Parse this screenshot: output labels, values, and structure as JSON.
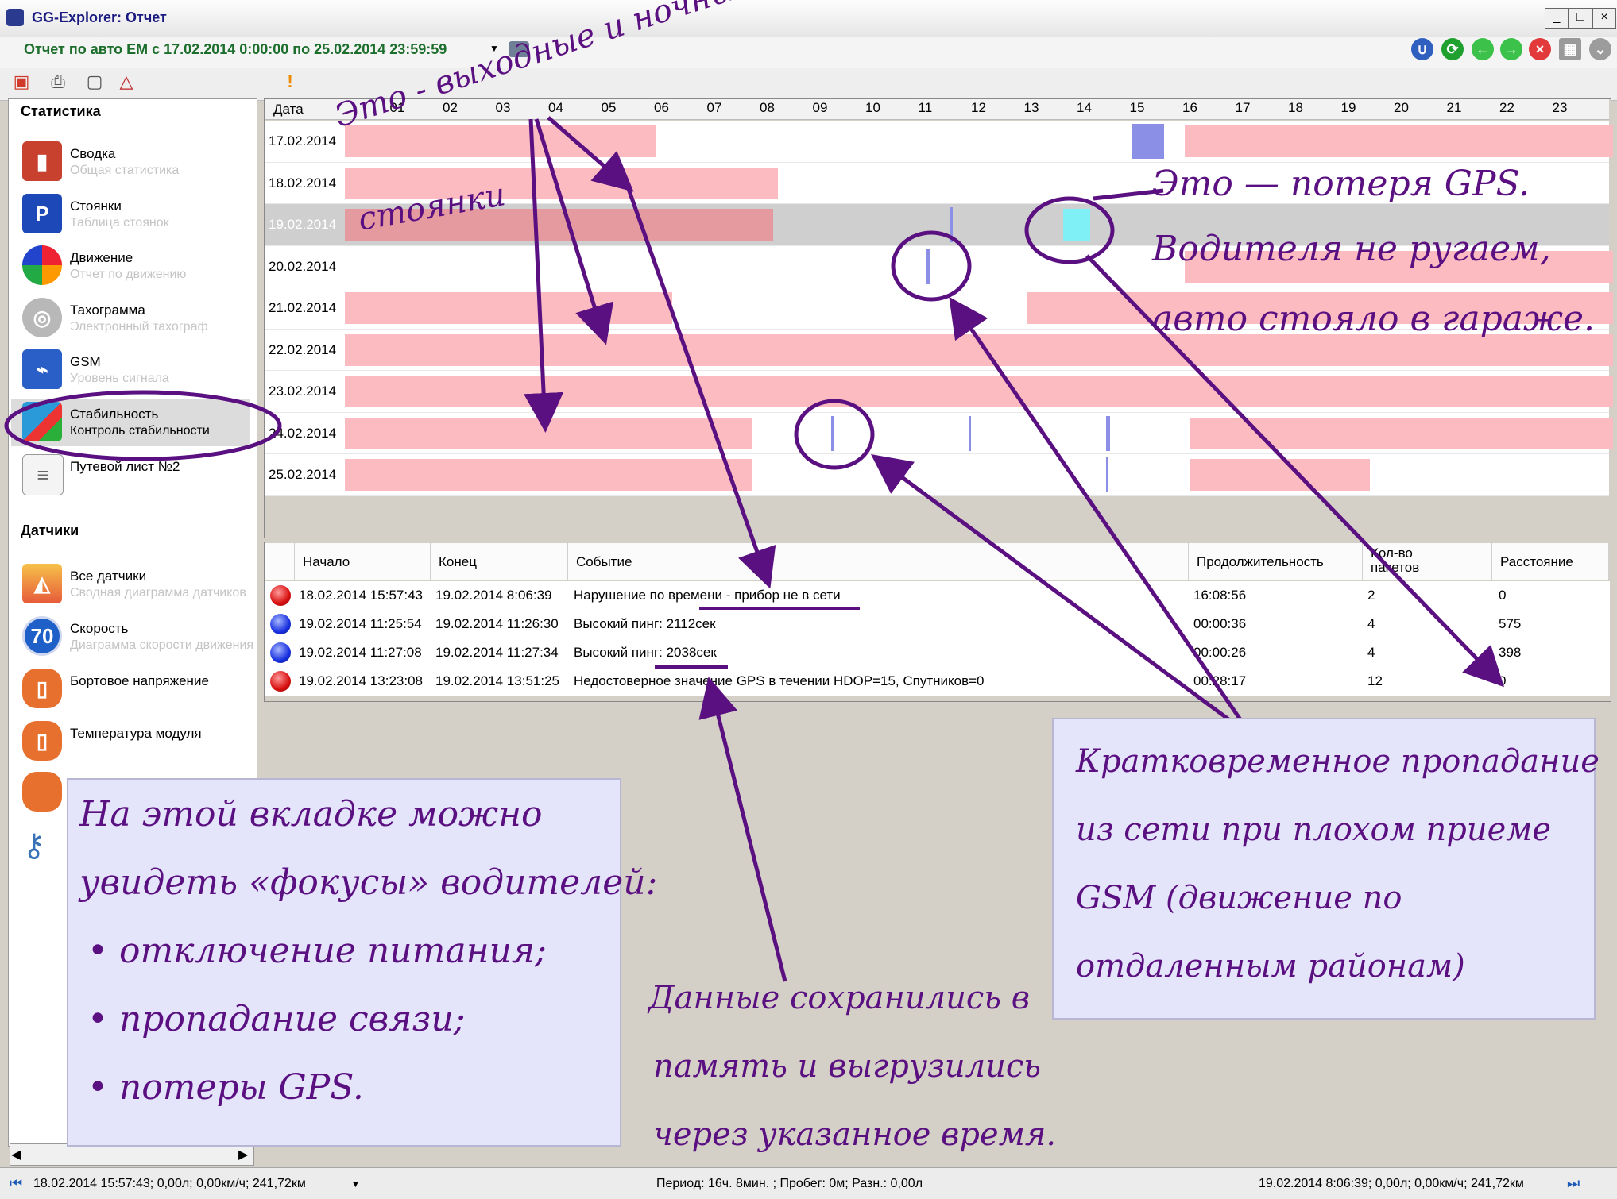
{
  "window": {
    "title": "GG-Explorer: Отчет",
    "controls": [
      "_",
      "□",
      "×"
    ]
  },
  "report": {
    "title": "Отчет по авто  ЕМ с 17.02.2014 0:00:00 по 25.02.2014 23:59:59"
  },
  "sidebar": {
    "stats_header": "Статистика",
    "sensors_header": "Датчики",
    "items": [
      {
        "title": "Сводка",
        "subtitle": "Общая статистика"
      },
      {
        "title": "Стоянки",
        "subtitle": "Таблица стоянок"
      },
      {
        "title": "Движение",
        "subtitle": "Отчет по движению"
      },
      {
        "title": "Тахограмма",
        "subtitle": "Электронный тахограф"
      },
      {
        "title": "GSM",
        "subtitle": "Уровень сигнала"
      },
      {
        "title": "Стабильность",
        "subtitle": "Контроль стабильности"
      },
      {
        "title": "Путевой лист №2",
        "subtitle": ""
      }
    ],
    "sensor_items": [
      {
        "title": "Все датчики",
        "subtitle": "Сводная диаграмма датчиков"
      },
      {
        "title": "Скорость",
        "subtitle": "Диаграмма скорости движения"
      },
      {
        "title": "Бортовое напряжение",
        "subtitle": ""
      },
      {
        "title": "Температура модуля",
        "subtitle": ""
      }
    ],
    "speed_icon_label": "70"
  },
  "timeline": {
    "date_header": "Дата",
    "hours": [
      "01",
      "02",
      "03",
      "04",
      "05",
      "06",
      "07",
      "08",
      "09",
      "10",
      "11",
      "12",
      "13",
      "14",
      "15",
      "16",
      "17",
      "18",
      "19",
      "20",
      "21",
      "22",
      "23"
    ],
    "rows": [
      {
        "date": "17.02.2014"
      },
      {
        "date": "18.02.2014"
      },
      {
        "date": "19.02.2014"
      },
      {
        "date": "20.02.2014"
      },
      {
        "date": "21.02.2014"
      },
      {
        "date": "22.02.2014"
      },
      {
        "date": "23.02.2014"
      },
      {
        "date": "24.02.2014"
      },
      {
        "date": "25.02.2014"
      }
    ]
  },
  "events": {
    "columns": [
      "Начало",
      "Конец",
      "Событие",
      "Продолжительность",
      "Кол-во пакетов",
      "Расстояние"
    ],
    "rows": [
      {
        "status": "red",
        "start": "18.02.2014 15:57:43",
        "end": "19.02.2014 8:06:39",
        "event": "Нарушение по времени - прибор не в сети",
        "duration": "16:08:56",
        "packets": "2",
        "distance": "0"
      },
      {
        "status": "blue",
        "start": "19.02.2014 11:25:54",
        "end": "19.02.2014 11:26:30",
        "event": "Высокий пинг: 2112сек",
        "duration": "00:00:36",
        "packets": "4",
        "distance": "575"
      },
      {
        "status": "blue",
        "start": "19.02.2014 11:27:08",
        "end": "19.02.2014 11:27:34",
        "event": "Высокий пинг: 2038сек",
        "duration": "00:00:26",
        "packets": "4",
        "distance": "398"
      },
      {
        "status": "red",
        "start": "19.02.2014 13:23:08",
        "end": "19.02.2014 13:51:25",
        "event": "Недостоверное значение GPS в течении HDOP=15, Спутников=0",
        "duration": "00:28:17",
        "packets": "12",
        "distance": "0"
      }
    ]
  },
  "status": {
    "left": "18.02.2014 15:57:43; 0,00л; 0,00км/ч; 241,72км",
    "center": "Период: 16ч. 8мин. ; Пробег: 0м; Разн.: 0,00л",
    "right": "19.02.2014 8:06:39; 0,00л; 0,00км/ч; 241,72км"
  },
  "annotations": {
    "weekend_1": "Это - выходные и ночные",
    "weekend_2": "стоянки",
    "gps_1": "Это — потеря GPS.",
    "gps_2": "Водителя не ругаем,",
    "gps_3": "авто стояло в гараже.",
    "tab_note_1": "На этой вкладке можно",
    "tab_note_2": "увидеть «фокусы» водителей:",
    "tab_note_bullets": [
      "отключение питания;",
      "пропадание связи;",
      "потеры GPS."
    ],
    "gsm_note": [
      "Кратковременное пропадание",
      "из сети при плохом приеме",
      "GSM (движение по",
      "отдаленным районам)"
    ],
    "memory_note": [
      "Данные сохранились в",
      "память и выгрузились",
      "через указанное время."
    ]
  },
  "colors": {
    "parking_bar": "#fbbbc1",
    "mark": "#8b8fe6",
    "gps_loss": "#7ff0f5",
    "annotation": "#5a1080",
    "accent_green": "#1c6e2c"
  }
}
